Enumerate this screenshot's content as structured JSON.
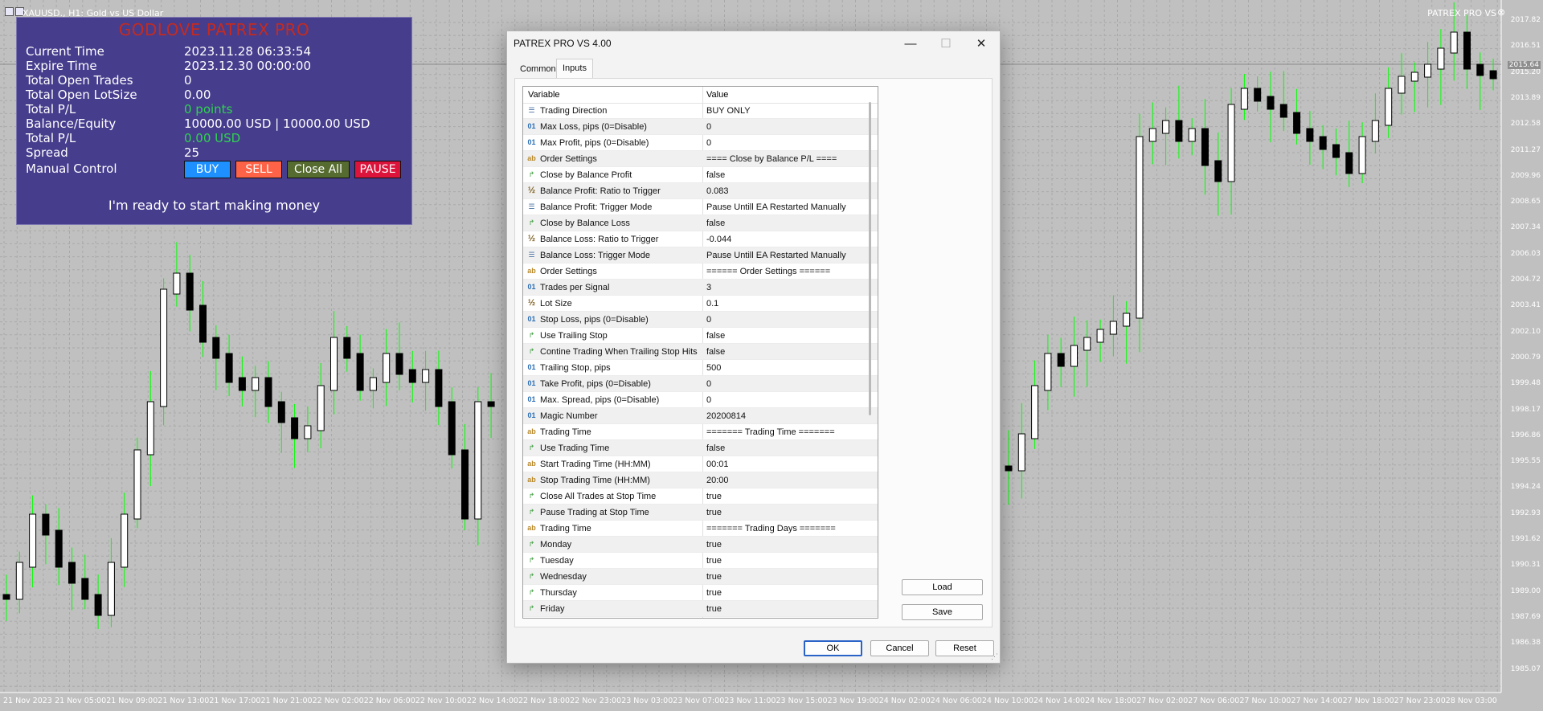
{
  "chart": {
    "symbol_title": "XAUUSD., H1:  Gold vs US Dollar",
    "brand": "PATREX PRO VS",
    "close_glyph": "⊗",
    "current_price": "2015.64",
    "price_axis": [
      "2017.82",
      "2016.51",
      "2015.20",
      "2013.89",
      "2012.58",
      "2011.27",
      "2009.96",
      "2008.65",
      "2007.34",
      "2006.03",
      "2004.72",
      "2003.41",
      "2002.10",
      "2000.79",
      "1999.48",
      "1998.17",
      "1996.86",
      "1995.55",
      "1994.24",
      "1992.93",
      "1991.62",
      "1990.31",
      "1989.00",
      "1987.69",
      "1986.38",
      "1985.07"
    ],
    "time_axis": [
      "21 Nov 2023",
      "21 Nov 05:00",
      "21 Nov 09:00",
      "21 Nov 13:00",
      "21 Nov 17:00",
      "21 Nov 21:00",
      "22 Nov 02:00",
      "22 Nov 06:00",
      "22 Nov 10:00",
      "22 Nov 14:00",
      "22 Nov 18:00",
      "22 Nov 23:00",
      "23 Nov 03:00",
      "23 Nov 07:00",
      "23 Nov 11:00",
      "23 Nov 15:00",
      "23 Nov 19:00",
      "24 Nov 02:00",
      "24 Nov 06:00",
      "24 Nov 10:00",
      "24 Nov 14:00",
      "24 Nov 18:00",
      "27 Nov 02:00",
      "27 Nov 06:00",
      "27 Nov 10:00",
      "27 Nov 14:00",
      "27 Nov 18:00",
      "27 Nov 23:00",
      "28 Nov 03:00"
    ],
    "colors": {
      "background": "#c0c0c0",
      "grid": "#a9a9a9",
      "bull_body": "#ffffff",
      "bear_body": "#000000",
      "wick": "#00ff00"
    }
  },
  "info_panel": {
    "title": "GODLOVE PATREX PRO",
    "rows": [
      {
        "label": "Current Time",
        "value": "2023.11.28 06:33:54"
      },
      {
        "label": "Expire Time",
        "value": "2023.12.30 00:00:00"
      },
      {
        "label": "Total Open Trades",
        "value": "0"
      },
      {
        "label": "Total Open LotSize",
        "value": "0.00"
      },
      {
        "label": "Total P/L",
        "value": "0 points"
      },
      {
        "label": "Balance/Equity",
        "value": "10000.00 USD | 10000.00 USD"
      },
      {
        "label": "Total P/L",
        "value": "0.00 USD"
      },
      {
        "label": "Spread",
        "value": "25"
      },
      {
        "label": "Manual Control",
        "value": ""
      }
    ],
    "buttons": {
      "buy": "BUY",
      "sell": "SELL",
      "close_all": "Close All",
      "pause": "PAUSE"
    },
    "message": "I'm ready to start making money",
    "colors": {
      "background": "#463d8d",
      "title": "#c42b20",
      "positive": "#2fd24f",
      "buy": "#1e90ff",
      "sell": "#ff6347",
      "close_all": "#556b2f",
      "pause": "#dc143c"
    }
  },
  "dialog": {
    "title": "PATREX PRO VS 4.00",
    "window_buttons": {
      "minimize": "—",
      "maximize": "☐",
      "close": "✕"
    },
    "tabs": [
      "Common",
      "Inputs"
    ],
    "columns": {
      "variable": "Variable",
      "value": "Value"
    },
    "rows": [
      {
        "icon": "enum",
        "variable": "Trading Direction",
        "value": "BUY ONLY"
      },
      {
        "icon": "int",
        "variable": "Max Loss, pips (0=Disable)",
        "value": "0"
      },
      {
        "icon": "int",
        "variable": "Max Profit, pips (0=Disable)",
        "value": "0"
      },
      {
        "icon": "str",
        "variable": "Order Settings",
        "value": "==== Close by Balance P/L ===="
      },
      {
        "icon": "bool",
        "variable": "Close by Balance Profit",
        "value": "false"
      },
      {
        "icon": "dbl",
        "variable": "Balance Profit: Ratio to Trigger",
        "value": "0.083"
      },
      {
        "icon": "enum",
        "variable": "Balance Profit: Trigger Mode",
        "value": "Pause Untill EA Restarted Manually"
      },
      {
        "icon": "bool",
        "variable": "Close by Balance Loss",
        "value": "false"
      },
      {
        "icon": "dbl",
        "variable": "Balance Loss: Ratio to Trigger",
        "value": "-0.044"
      },
      {
        "icon": "enum",
        "variable": "Balance Loss: Trigger Mode",
        "value": "Pause Untill EA Restarted Manually"
      },
      {
        "icon": "str",
        "variable": "Order Settings",
        "value": "====== Order Settings ======"
      },
      {
        "icon": "int",
        "variable": "Trades per Signal",
        "value": "3"
      },
      {
        "icon": "dbl",
        "variable": "Lot Size",
        "value": "0.1"
      },
      {
        "icon": "int",
        "variable": "Stop Loss, pips (0=Disable)",
        "value": "0"
      },
      {
        "icon": "bool",
        "variable": "Use Trailing Stop",
        "value": "false"
      },
      {
        "icon": "bool",
        "variable": "Contine Trading When Trailing Stop Hits",
        "value": "false"
      },
      {
        "icon": "int",
        "variable": "Trailing Stop, pips",
        "value": "500"
      },
      {
        "icon": "int",
        "variable": "Take Profit, pips (0=Disable)",
        "value": "0"
      },
      {
        "icon": "int",
        "variable": "Max. Spread, pips (0=Disable)",
        "value": "0"
      },
      {
        "icon": "int",
        "variable": "Magic Number",
        "value": "20200814"
      },
      {
        "icon": "str",
        "variable": "Trading Time",
        "value": "======= Trading Time ======="
      },
      {
        "icon": "bool",
        "variable": "Use Trading Time",
        "value": "false"
      },
      {
        "icon": "str",
        "variable": "Start Trading Time (HH:MM)",
        "value": "00:01"
      },
      {
        "icon": "str",
        "variable": "Stop Trading Time (HH:MM)",
        "value": "20:00"
      },
      {
        "icon": "bool",
        "variable": "Close All Trades at Stop Time",
        "value": "true"
      },
      {
        "icon": "bool",
        "variable": "Pause Trading at Stop Time",
        "value": "true"
      },
      {
        "icon": "str",
        "variable": "Trading Time",
        "value": "======= Trading Days ======="
      },
      {
        "icon": "bool",
        "variable": "Monday",
        "value": "true"
      },
      {
        "icon": "bool",
        "variable": "Tuesday",
        "value": "true"
      },
      {
        "icon": "bool",
        "variable": "Wednesday",
        "value": "true"
      },
      {
        "icon": "bool",
        "variable": "Thursday",
        "value": "true"
      },
      {
        "icon": "bool",
        "variable": "Friday",
        "value": "true"
      }
    ],
    "side_buttons": {
      "load": "Load",
      "save": "Save"
    },
    "bottom_buttons": {
      "ok": "OK",
      "cancel": "Cancel",
      "reset": "Reset"
    }
  }
}
